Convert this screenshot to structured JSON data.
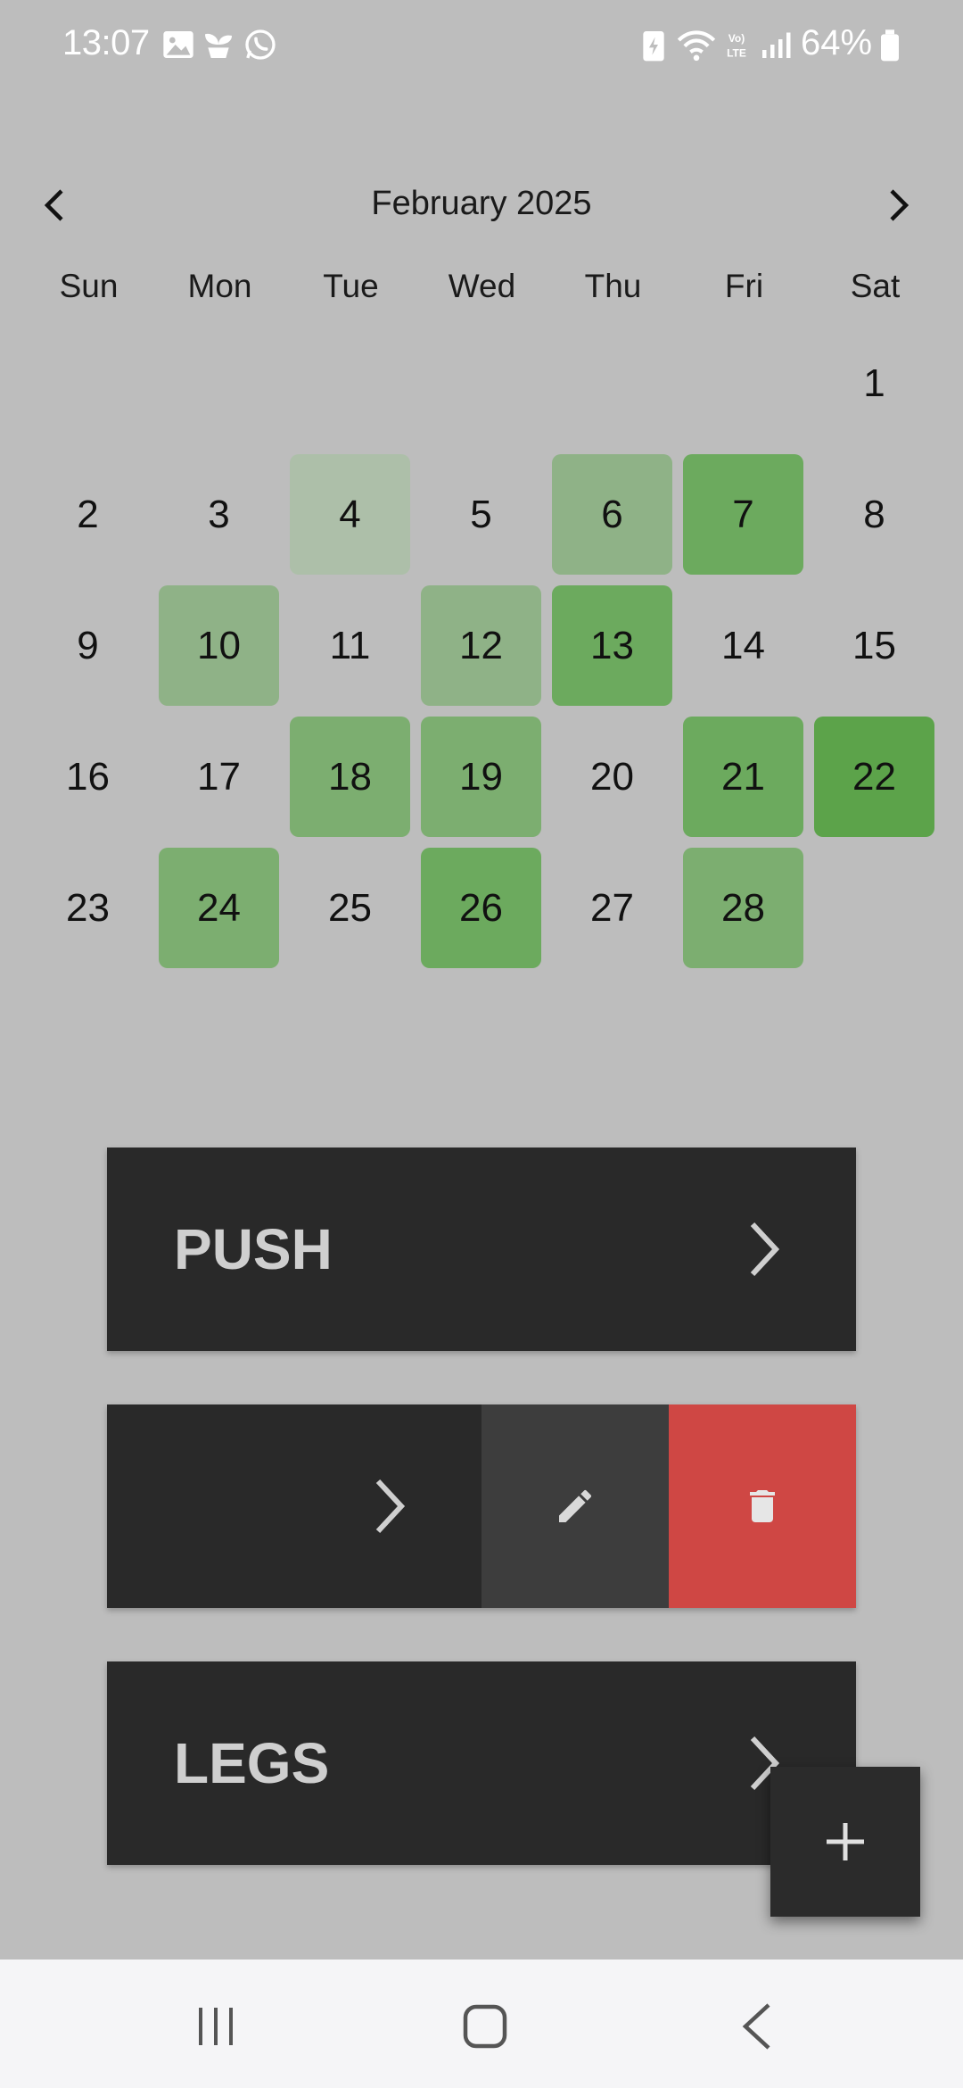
{
  "status_bar": {
    "time": "13:07",
    "battery_percent": "64%",
    "icons": [
      "gallery-icon",
      "plant-icon",
      "whatsapp-icon",
      "battery-saver-icon",
      "wifi-icon",
      "volte-icon",
      "signal-icon",
      "battery-icon"
    ]
  },
  "calendar": {
    "month_title": "February 2025",
    "weekdays": [
      "Sun",
      "Mon",
      "Tue",
      "Wed",
      "Thu",
      "Fri",
      "Sat"
    ],
    "days": [
      {
        "d": "1",
        "col": 6,
        "row": 0,
        "color": ""
      },
      {
        "d": "2",
        "col": 0,
        "row": 1,
        "color": ""
      },
      {
        "d": "3",
        "col": 1,
        "row": 1,
        "color": ""
      },
      {
        "d": "4",
        "col": 2,
        "row": 1,
        "color": "#adbfa9"
      },
      {
        "d": "5",
        "col": 3,
        "row": 1,
        "color": ""
      },
      {
        "d": "6",
        "col": 4,
        "row": 1,
        "color": "#8fb287"
      },
      {
        "d": "7",
        "col": 5,
        "row": 1,
        "color": "#6caa5e"
      },
      {
        "d": "8",
        "col": 6,
        "row": 1,
        "color": ""
      },
      {
        "d": "9",
        "col": 0,
        "row": 2,
        "color": ""
      },
      {
        "d": "10",
        "col": 1,
        "row": 2,
        "color": "#8fb287"
      },
      {
        "d": "11",
        "col": 2,
        "row": 2,
        "color": ""
      },
      {
        "d": "12",
        "col": 3,
        "row": 2,
        "color": "#8fb287"
      },
      {
        "d": "13",
        "col": 4,
        "row": 2,
        "color": "#6caa5e"
      },
      {
        "d": "14",
        "col": 5,
        "row": 2,
        "color": ""
      },
      {
        "d": "15",
        "col": 6,
        "row": 2,
        "color": ""
      },
      {
        "d": "16",
        "col": 0,
        "row": 3,
        "color": ""
      },
      {
        "d": "17",
        "col": 1,
        "row": 3,
        "color": ""
      },
      {
        "d": "18",
        "col": 2,
        "row": 3,
        "color": "#7cae70"
      },
      {
        "d": "19",
        "col": 3,
        "row": 3,
        "color": "#7cae70"
      },
      {
        "d": "20",
        "col": 4,
        "row": 3,
        "color": ""
      },
      {
        "d": "21",
        "col": 5,
        "row": 3,
        "color": "#6caa5e"
      },
      {
        "d": "22",
        "col": 6,
        "row": 3,
        "color": "#5ca34a"
      },
      {
        "d": "23",
        "col": 0,
        "row": 4,
        "color": ""
      },
      {
        "d": "24",
        "col": 1,
        "row": 4,
        "color": "#7cae70"
      },
      {
        "d": "25",
        "col": 2,
        "row": 4,
        "color": ""
      },
      {
        "d": "26",
        "col": 3,
        "row": 4,
        "color": "#6caa5e"
      },
      {
        "d": "27",
        "col": 4,
        "row": 4,
        "color": ""
      },
      {
        "d": "28",
        "col": 5,
        "row": 4,
        "color": "#7cae70"
      }
    ]
  },
  "workouts": [
    {
      "title": "PUSH"
    },
    {
      "title": ""
    },
    {
      "title": "LEGS"
    }
  ],
  "colors": {
    "background": "#bdbdbd",
    "card": "#292929",
    "edit_action": "#3d3d3d",
    "delete_action": "#cf4744",
    "nav_bar": "#f5f5f7"
  }
}
